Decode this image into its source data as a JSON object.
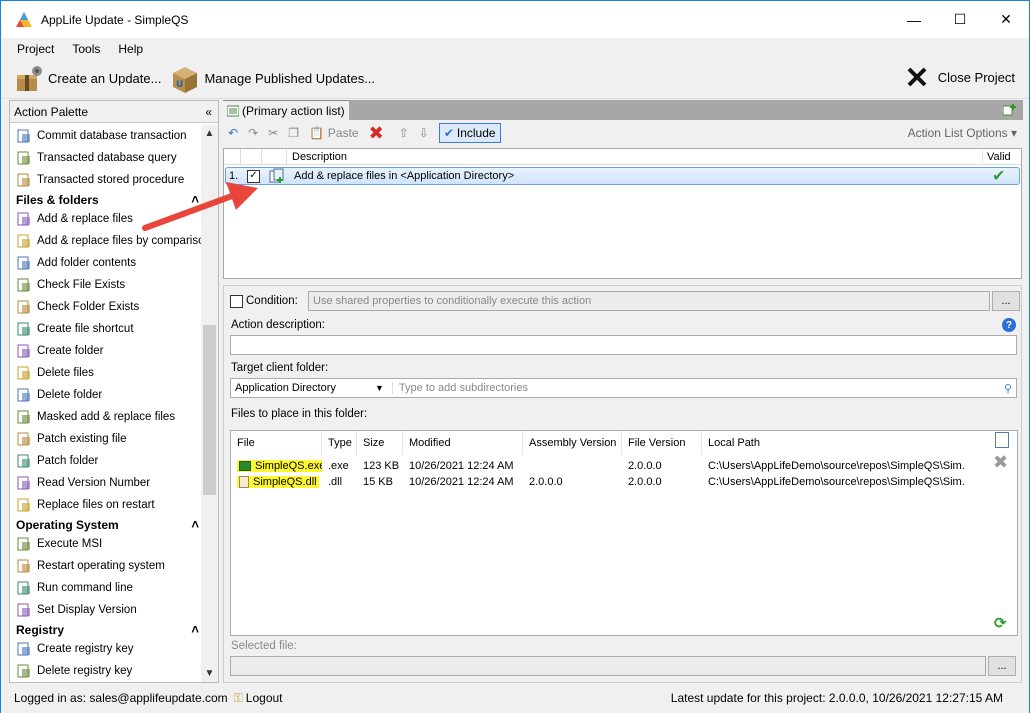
{
  "window": {
    "title": "AppLife Update - SimpleQS"
  },
  "menu": [
    "Project",
    "Tools",
    "Help"
  ],
  "toolbar": {
    "create_update": "Create an Update...",
    "manage_published": "Manage Published Updates...",
    "close_project": "Close Project"
  },
  "palette": {
    "title": "Action Palette",
    "groups": [
      {
        "type": "item",
        "label": "Commit database transaction",
        "icon": "database-icon"
      },
      {
        "type": "item",
        "label": "Transacted database query",
        "icon": "sql-icon"
      },
      {
        "type": "item",
        "label": "Transacted stored procedure",
        "icon": "stored-procedure-icon"
      },
      {
        "type": "cat",
        "label": "Files & folders"
      },
      {
        "type": "item",
        "label": "Add & replace files",
        "icon": "add-files-icon"
      },
      {
        "type": "item",
        "label": "Add & replace files by comparison",
        "icon": "compare-files-icon"
      },
      {
        "type": "item",
        "label": "Add folder contents",
        "icon": "folder-add-icon"
      },
      {
        "type": "item",
        "label": "Check File Exists",
        "icon": "check-file-icon"
      },
      {
        "type": "item",
        "label": "Check Folder Exists",
        "icon": "check-folder-icon"
      },
      {
        "type": "item",
        "label": "Create file shortcut",
        "icon": "shortcut-icon"
      },
      {
        "type": "item",
        "label": "Create folder",
        "icon": "folder-new-icon"
      },
      {
        "type": "item",
        "label": "Delete files",
        "icon": "delete-files-icon"
      },
      {
        "type": "item",
        "label": "Delete folder",
        "icon": "delete-folder-icon"
      },
      {
        "type": "item",
        "label": "Masked add & replace files",
        "icon": "masked-files-icon"
      },
      {
        "type": "item",
        "label": "Patch existing file",
        "icon": "patch-file-icon"
      },
      {
        "type": "item",
        "label": "Patch folder",
        "icon": "patch-folder-icon"
      },
      {
        "type": "item",
        "label": "Read Version Number",
        "icon": "read-version-icon"
      },
      {
        "type": "item",
        "label": "Replace files on restart",
        "icon": "replace-restart-icon"
      },
      {
        "type": "cat",
        "label": "Operating System"
      },
      {
        "type": "item",
        "label": "Execute MSI",
        "icon": "msi-icon"
      },
      {
        "type": "item",
        "label": "Restart operating system",
        "icon": "restart-icon"
      },
      {
        "type": "item",
        "label": "Run command line",
        "icon": "command-line-icon"
      },
      {
        "type": "item",
        "label": "Set Display Version",
        "icon": "display-version-icon"
      },
      {
        "type": "cat",
        "label": "Registry"
      },
      {
        "type": "item",
        "label": "Create registry key",
        "icon": "registry-key-icon"
      },
      {
        "type": "item",
        "label": "Delete registry key",
        "icon": "delete-registry-icon"
      }
    ]
  },
  "tab": {
    "label": "(Primary action list)"
  },
  "actionbar": {
    "paste": "Paste",
    "include": "Include",
    "options": "Action List Options"
  },
  "grid": {
    "headers": {
      "description": "Description",
      "valid": "Valid"
    },
    "row": {
      "index": "1.",
      "description": "Add & replace files in <Application Directory>"
    }
  },
  "details": {
    "condition_label": "Condition:",
    "condition_placeholder": "Use shared properties to conditionally execute this action",
    "condition_btn": "...",
    "action_description_label": "Action description:",
    "action_description_value": "",
    "target_label": "Target client folder:",
    "target_value": "Application Directory",
    "subdir_placeholder": "Type to add subdirectories",
    "files_label": "Files to place in this folder:",
    "selected_file_label": "Selected file:",
    "selected_file_btn": "..."
  },
  "files": {
    "headers": [
      "File",
      "Type",
      "Size",
      "Modified",
      "Assembly Version",
      "File Version",
      "Local Path"
    ],
    "rows": [
      {
        "file": "SimpleQS.exe",
        "type": ".exe",
        "size": "123 KB",
        "modified": "10/26/2021 12:24 AM",
        "assembly": "",
        "version": "2.0.0.0",
        "path": "C:\\Users\\AppLifeDemo\\source\\repos\\SimpleQS\\Sim..."
      },
      {
        "file": "SimpleQS.dll",
        "type": ".dll",
        "size": "15 KB",
        "modified": "10/26/2021 12:24 AM",
        "assembly": "2.0.0.0",
        "version": "2.0.0.0",
        "path": "C:\\Users\\AppLifeDemo\\source\\repos\\SimpleQS\\Sim..."
      }
    ]
  },
  "status": {
    "logged_in": "Logged in as: sales@applifeupdate.com",
    "logout": "Logout",
    "latest": "Latest update for this project: 2.0.0.0, 10/26/2021 12:27:15 AM"
  },
  "colors": {
    "accent": "#1883d7",
    "highlight": "#fff830",
    "arrow": "#e8463a",
    "valid": "#3a9a3a"
  }
}
